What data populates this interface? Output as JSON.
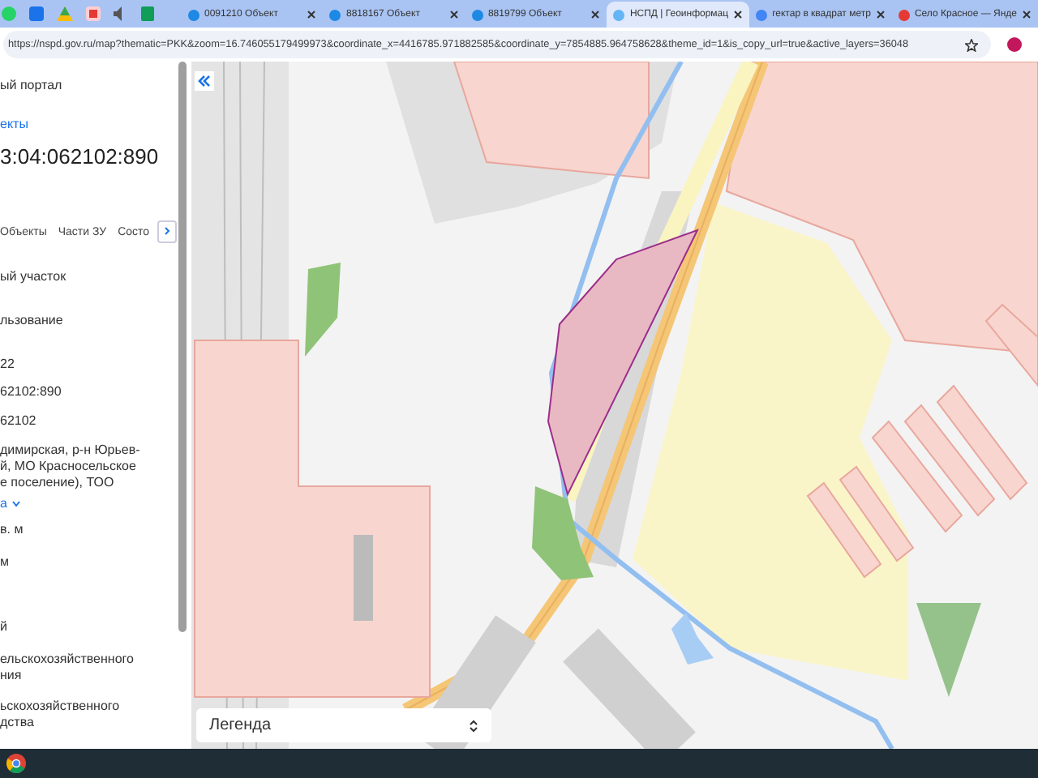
{
  "browser": {
    "tabs": [
      {
        "title": "0091210 Объект",
        "selected": false
      },
      {
        "title": "8818167 Объект",
        "selected": false
      },
      {
        "title": "8819799 Объект",
        "selected": false
      },
      {
        "title": "НСПД | Геоинформац",
        "selected": true
      },
      {
        "title": "гектар в квадрат метр",
        "selected": false
      },
      {
        "title": "Село Красное — Янде",
        "selected": false
      }
    ],
    "address": "https://nspd.gov.ru/map?thematic=PKK&zoom=16.746055179499973&coordinate_x=4416785.971882585&coordinate_y=7854885.964758628&theme_id=1&is_copy_url=true&active_layers=36048"
  },
  "panel": {
    "header": "ый портал",
    "breadcrumb": "екты",
    "cadastral_number": "3:04:062102:890",
    "tabs": [
      {
        "label": "Объекты",
        "selected": false
      },
      {
        "label": "Части ЗУ",
        "selected": false
      },
      {
        "label": "Состо",
        "selected": false
      }
    ],
    "fields": [
      {
        "kind": "text",
        "lines": [
          "ый участок"
        ]
      },
      {
        "kind": "text",
        "lines": [
          "льзование"
        ]
      },
      {
        "kind": "text",
        "lines": [
          "22"
        ]
      },
      {
        "kind": "text",
        "lines": [
          "62102:890"
        ]
      },
      {
        "kind": "text",
        "lines": [
          "62102"
        ]
      },
      {
        "kind": "text",
        "lines": [
          "димирская, р-н Юрьев-",
          "й, МО Красносельское",
          "е поселение), ТОО"
        ]
      },
      {
        "kind": "link",
        "lines": [
          "а"
        ]
      },
      {
        "kind": "text",
        "lines": [
          "в. м"
        ]
      },
      {
        "kind": "text",
        "lines": [
          "м"
        ]
      },
      {
        "kind": "text",
        "lines": [
          "й"
        ]
      },
      {
        "kind": "text",
        "lines": [
          "ельскохозяйственного",
          "ния"
        ]
      },
      {
        "kind": "text",
        "lines": [
          "ьскохозяйственного",
          "дства"
        ]
      }
    ]
  },
  "map": {
    "legend": {
      "label": "Легенда"
    }
  }
}
